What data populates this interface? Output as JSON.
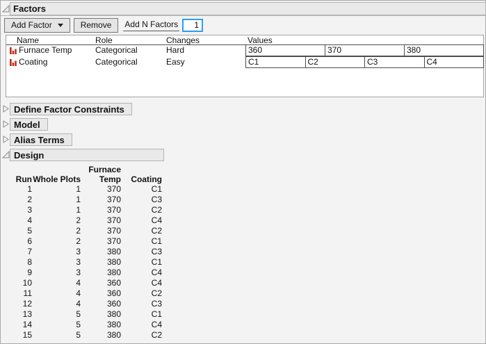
{
  "factors_panel": {
    "title": "Factors",
    "toolbar": {
      "add_factor_label": "Add Factor",
      "remove_label": "Remove",
      "add_n_factors_label": "Add N Factors",
      "add_n_factors_value": "1"
    },
    "table": {
      "columns": [
        "Name",
        "Role",
        "Changes",
        "Values"
      ],
      "rows": [
        {
          "icon": "categorical-bars-icon",
          "name": "Furnace Temp",
          "role": "Categorical",
          "changes": "Hard",
          "values": [
            "360",
            "370",
            "380"
          ]
        },
        {
          "icon": "categorical-bars-icon",
          "name": "Coating",
          "role": "Categorical",
          "changes": "Easy",
          "values": [
            "C1",
            "C2",
            "C3",
            "C4"
          ]
        }
      ]
    }
  },
  "collapsed_panels": [
    {
      "title": "Define Factor Constraints"
    },
    {
      "title": "Model"
    },
    {
      "title": "Alias Terms"
    }
  ],
  "design_panel": {
    "title": "Design",
    "header_line1": [
      "",
      "",
      "Furnace",
      ""
    ],
    "header_line2": [
      "Run",
      "Whole Plots",
      "Temp",
      "Coating"
    ],
    "rows": [
      [
        "1",
        "1",
        "370",
        "C1"
      ],
      [
        "2",
        "1",
        "370",
        "C3"
      ],
      [
        "3",
        "1",
        "370",
        "C2"
      ],
      [
        "4",
        "2",
        "370",
        "C4"
      ],
      [
        "5",
        "2",
        "370",
        "C2"
      ],
      [
        "6",
        "2",
        "370",
        "C1"
      ],
      [
        "7",
        "3",
        "380",
        "C3"
      ],
      [
        "8",
        "3",
        "380",
        "C1"
      ],
      [
        "9",
        "3",
        "380",
        "C4"
      ],
      [
        "10",
        "4",
        "360",
        "C4"
      ],
      [
        "11",
        "4",
        "360",
        "C2"
      ],
      [
        "12",
        "4",
        "360",
        "C3"
      ],
      [
        "13",
        "5",
        "380",
        "C1"
      ],
      [
        "14",
        "5",
        "380",
        "C4"
      ],
      [
        "15",
        "5",
        "380",
        "C2"
      ]
    ]
  },
  "colors": {
    "factor_icon_red": "#c42b1c",
    "focus_border_blue": "#2a9df4",
    "panel_header_bg": "#e9e9e9",
    "page_bg": "#f3f3f3"
  }
}
